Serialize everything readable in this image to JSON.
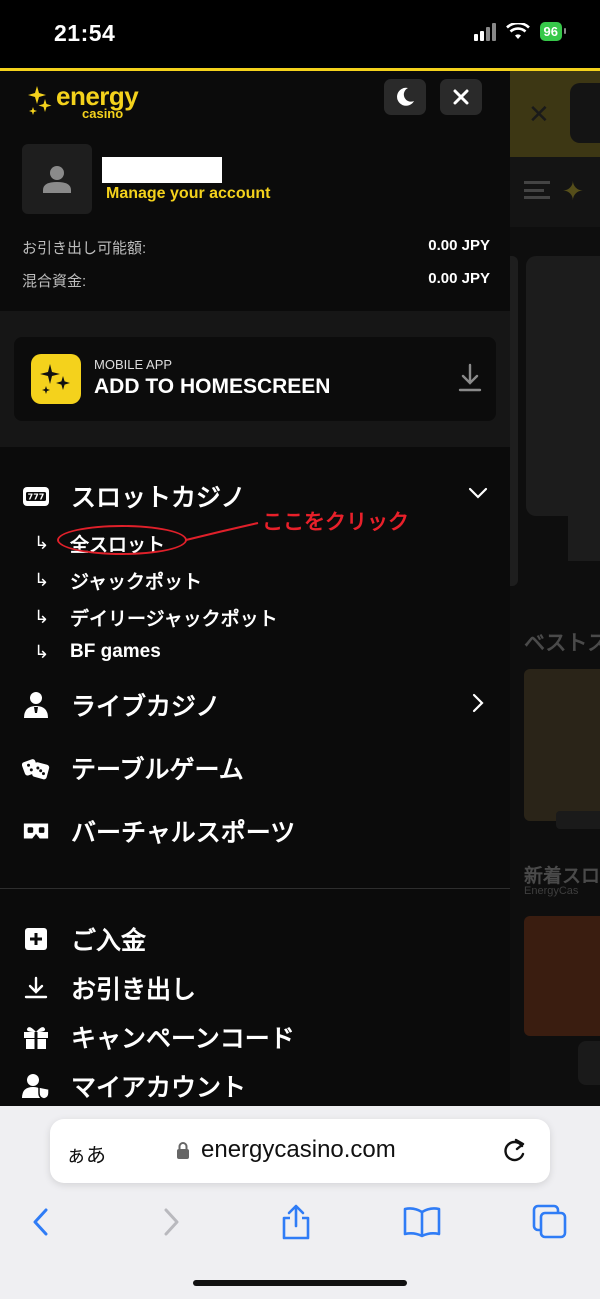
{
  "status_bar": {
    "time": "21:54",
    "battery": "96"
  },
  "drawer": {
    "logo": {
      "word": "energy",
      "sub": "casino"
    },
    "account": {
      "manage_label": "Manage your account"
    },
    "balances": [
      {
        "label": "お引き出し可能額:",
        "value": "0.00 JPY"
      },
      {
        "label": "混合資金:",
        "value": "0.00 JPY"
      }
    ],
    "app_promo": {
      "small": "MOBILE APP",
      "big": "ADD TO HOMESCREEN"
    },
    "menu": {
      "slots": {
        "label": "スロットカジノ",
        "subitems": [
          "全スロット",
          "ジャックポット",
          "デイリージャックポット",
          "BF games"
        ]
      },
      "live": {
        "label": "ライブカジノ"
      },
      "table": {
        "label": "テーブルゲーム"
      },
      "virtual": {
        "label": "バーチャルスポーツ"
      },
      "deposit": {
        "label": "ご入金"
      },
      "withdraw": {
        "label": "お引き出し"
      },
      "campaign": {
        "label": "キャンペーンコード"
      },
      "myaccount": {
        "label": "マイアカウント"
      }
    }
  },
  "annotation": {
    "text": "ここをクリック",
    "color": "#e8202a"
  },
  "background_page": {
    "best_heading": "ベストス",
    "new_heading": "新着スロ",
    "new_sub": "EnergyCas"
  },
  "safari": {
    "aa_label": "ぁあ",
    "url": "energycasino.com"
  },
  "colors": {
    "accent": "#f4d21c",
    "ios_blue": "#2f7cf6"
  },
  "icons": {
    "moon": "moon-icon",
    "close": "close-icon",
    "download": "download-icon",
    "slot": "slot-machine-icon",
    "live": "dealer-icon",
    "dice": "dice-icon",
    "vr": "vr-headset-icon",
    "plus": "plus-square-icon",
    "withdraw": "download-tray-icon",
    "gift": "gift-icon",
    "user": "user-shield-icon"
  }
}
